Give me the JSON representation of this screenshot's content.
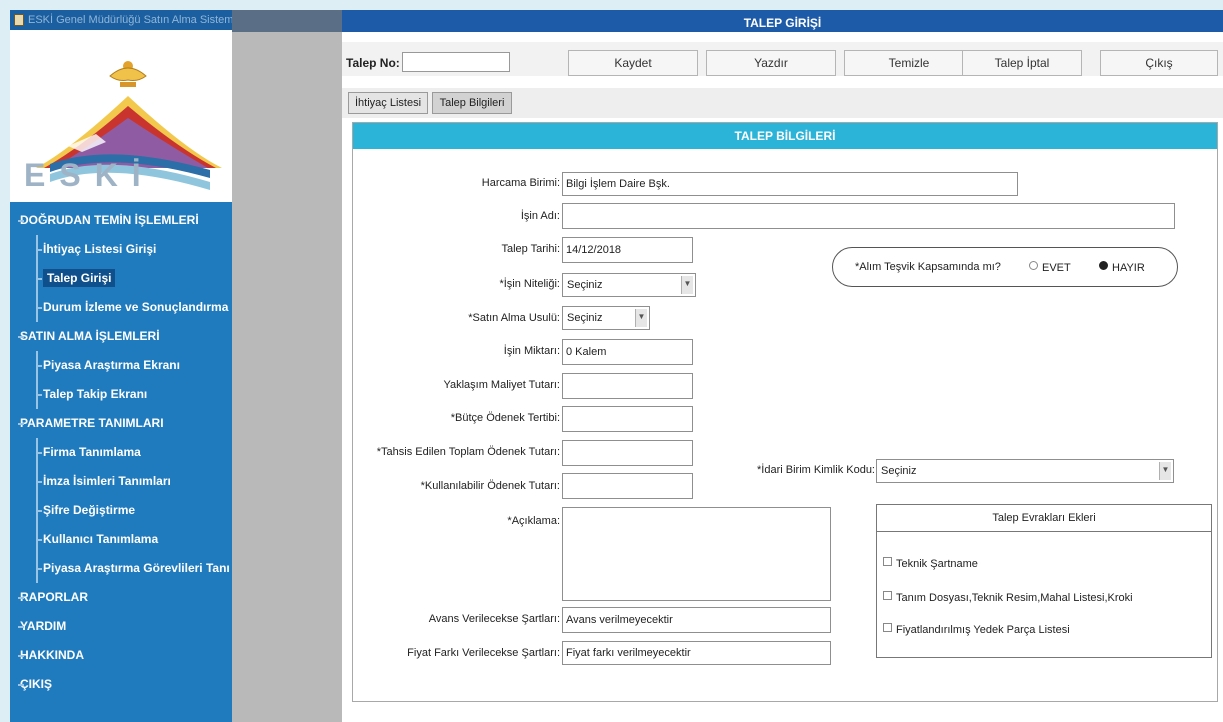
{
  "window": {
    "title": "ESKİ Genel Müdürlüğü Satın Alma Sistemi"
  },
  "logo": {
    "text": "ESKİ"
  },
  "sidebar": {
    "items": [
      {
        "label": "DOĞRUDAN TEMİN İŞLEMLERİ",
        "level": 0
      },
      {
        "label": "İhtiyaç Listesi Girişi",
        "level": 1
      },
      {
        "label": "Talep Girişi",
        "level": 1,
        "selected": true
      },
      {
        "label": "Durum İzleme ve Sonuçlandırma",
        "level": 1
      },
      {
        "label": "SATIN ALMA İŞLEMLERİ",
        "level": 0
      },
      {
        "label": "Piyasa Araştırma Ekranı",
        "level": 1
      },
      {
        "label": "Talep Takip Ekranı",
        "level": 1
      },
      {
        "label": "PARAMETRE TANIMLARI",
        "level": 0
      },
      {
        "label": "Firma Tanımlama",
        "level": 1
      },
      {
        "label": "İmza İsimleri Tanımları",
        "level": 1
      },
      {
        "label": "Şifre Değiştirme",
        "level": 1
      },
      {
        "label": "Kullanıcı Tanımlama",
        "level": 1
      },
      {
        "label": "Piyasa Araştırma Görevlileri Tanı",
        "level": 1
      },
      {
        "label": "RAPORLAR",
        "level": 0
      },
      {
        "label": "YARDIM",
        "level": 0
      },
      {
        "label": "HAKKINDA",
        "level": 0
      },
      {
        "label": "ÇIKIŞ",
        "level": 0
      }
    ]
  },
  "main": {
    "title": "TALEP GİRİŞİ",
    "talep_no_label": "Talep No:",
    "talep_no_value": "",
    "buttons": {
      "kaydet": "Kaydet",
      "yazdir": "Yazdır",
      "temizle": "Temizle",
      "talep_iptal": "Talep İptal",
      "cikis": "Çıkış"
    },
    "tabs": [
      {
        "label": "İhtiyaç Listesi"
      },
      {
        "label": "Talep Bilgileri"
      }
    ]
  },
  "form": {
    "header": "TALEP BİLGİLERİ",
    "harcama_birimi": {
      "label": "Harcama Birimi:",
      "value": "Bilgi İşlem Daire Bşk."
    },
    "isin_adi": {
      "label": "İşin Adı:",
      "value": ""
    },
    "talep_tarihi": {
      "label": "Talep Tarihi:",
      "value": "14/12/2018"
    },
    "isin_niteligi": {
      "label": "*İşin Niteliği:",
      "value": "Seçiniz"
    },
    "satin_alma_usulu": {
      "label": "*Satın Alma Usulü:",
      "value": "Seçiniz"
    },
    "isin_miktari": {
      "label": "İşin Miktarı:",
      "value": "0 Kalem"
    },
    "yaklasik_maliyet": {
      "label": "Yaklaşım Maliyet Tutarı:",
      "value": ""
    },
    "butce_odenek": {
      "label": "*Bütçe Ödenek Tertibi:",
      "value": ""
    },
    "tahsis_edilen": {
      "label": "*Tahsis Edilen Toplam Ödenek Tutarı:",
      "value": ""
    },
    "kullanilabilir": {
      "label": "*Kullanılabilir Ödenek Tutarı:",
      "value": ""
    },
    "aciklama": {
      "label": "*Açıklama:",
      "value": ""
    },
    "avans": {
      "label": "Avans Verilecekse Şartları:",
      "value": "Avans verilmeyecektir"
    },
    "fiyat_farki": {
      "label": "Fiyat Farkı Verilecekse Şartları:",
      "value": "Fiyat farkı verilmeyecektir"
    },
    "tesvik": {
      "question": "*Alım Teşvik Kapsamında mı?",
      "opt_evet": "EVET",
      "opt_hayir": "HAYIR",
      "selected": "HAYIR"
    },
    "idari_birim": {
      "label": "*İdari Birim Kimlik Kodu:",
      "value": "Seçiniz"
    },
    "evrak": {
      "title": "Talep Evrakları Ekleri",
      "items": [
        {
          "label": "Teknik Şartname",
          "checked": false
        },
        {
          "label": "Tanım Dosyası,Teknik Resim,Mahal Listesi,Kroki",
          "checked": false
        },
        {
          "label": "Fiyatlandırılmış Yedek Parça Listesi",
          "checked": false
        }
      ]
    }
  },
  "colors": {
    "sidebar_bg": "#1f7bbd",
    "title_bar": "#1d5aa8",
    "form_header": "#2bb3d8",
    "page_bg": "#ddeef4"
  }
}
